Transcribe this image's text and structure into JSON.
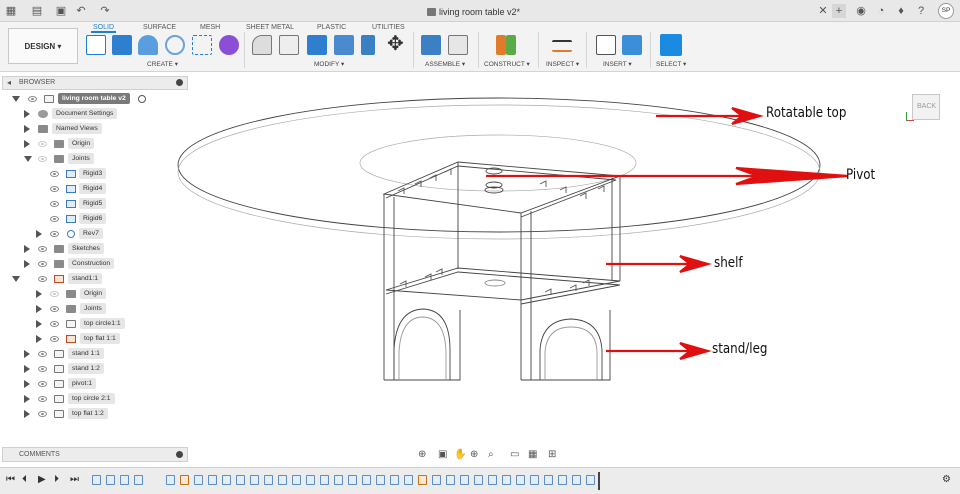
{
  "window": {
    "document_title": "living room table v2*"
  },
  "ribbon": {
    "workspace": "DESIGN",
    "tabs": [
      "SOLID",
      "SURFACE",
      "MESH",
      "SHEET METAL",
      "PLASTIC",
      "UTILITIES"
    ],
    "active_tab": "SOLID",
    "groups": [
      "CREATE",
      "MODIFY",
      "ASSEMBLE",
      "CONSTRUCT",
      "INSPECT",
      "INSERT",
      "SELECT"
    ]
  },
  "user": {
    "initials": "SP"
  },
  "browser": {
    "header": "BROWSER",
    "root": "living room table v2",
    "items": [
      "Document Settings",
      "Named Views",
      "Origin",
      "Joints",
      "Rigid3",
      "Rigid4",
      "Rigid5",
      "Rigid6",
      "Rev7",
      "Sketches",
      "Construction",
      "stand1:1",
      "Origin",
      "Joints",
      "top circle1:1",
      "top flat 1:1",
      "stand 1:1",
      "stand 1:2",
      "pivot:1",
      "top circle 2:1",
      "top flat 1:2"
    ]
  },
  "comments": {
    "label": "COMMENTS"
  },
  "viewcube": {
    "face": "BACK"
  },
  "annotations": {
    "top": "Rotatable top",
    "pivot": "Pivot",
    "shelf": "shelf",
    "stand": "stand/leg"
  },
  "colors": {
    "accent": "#1f7ecf",
    "annotation_arrow": "#e01010",
    "root_node": "#7a7a7a"
  },
  "icons": [
    "grid-menu-icon",
    "file-icon",
    "save-icon",
    "undo-icon",
    "redo-icon",
    "close-icon",
    "add-tab-icon",
    "extensions-icon",
    "job-status-icon",
    "notifications-icon",
    "help-icon",
    "settings-icon"
  ]
}
